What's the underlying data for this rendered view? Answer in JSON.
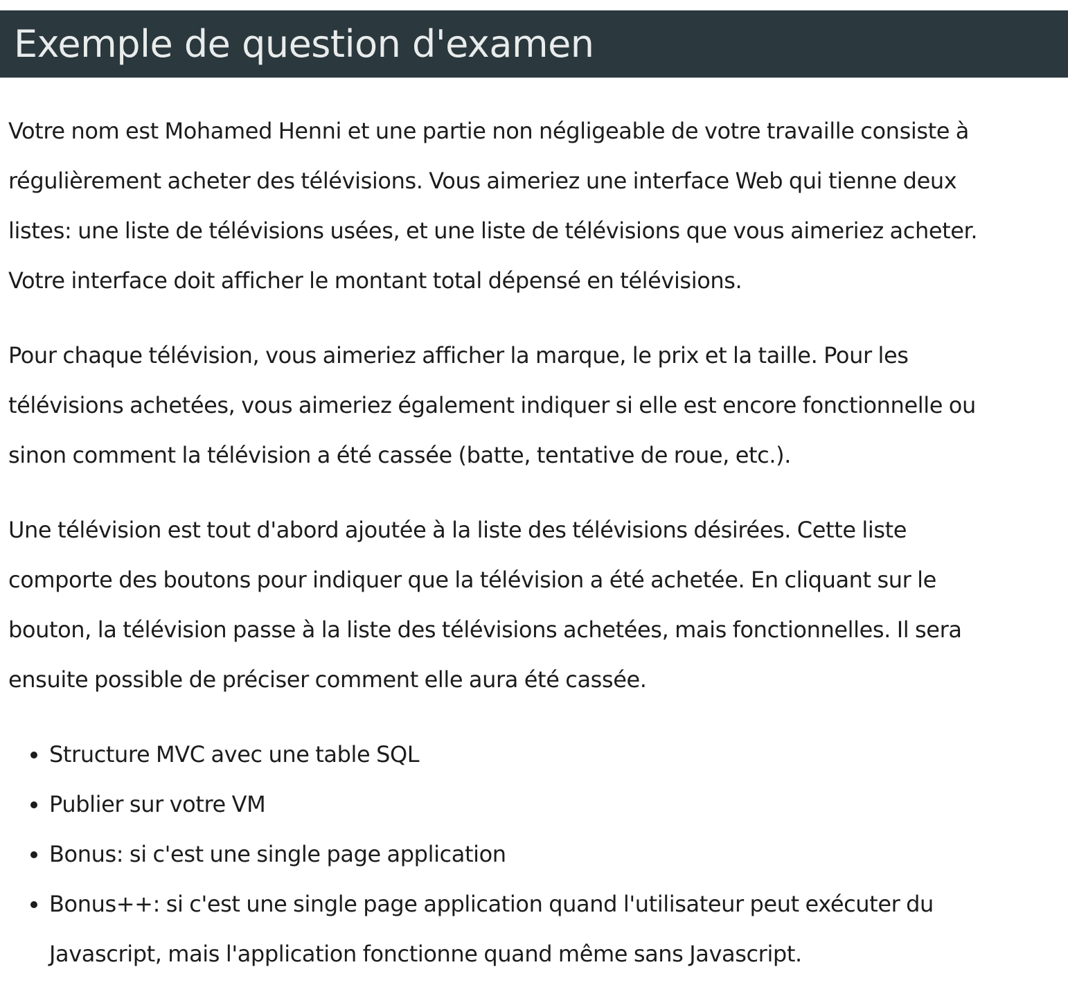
{
  "title": "Exemple de question d'examen",
  "paragraphs": [
    "Votre nom est Mohamed Henni et une partie non négligeable de votre travaille consiste à régulièrement acheter des télévisions. Vous aimeriez une interface Web qui tienne deux listes: une liste de télévisions usées, et une liste de télévisions que vous aimeriez acheter. Votre interface doit afficher le montant total dépensé en télévisions.",
    "Pour chaque télévision, vous aimeriez afficher la marque, le prix et la taille. Pour les télévisions achetées, vous aimeriez également indiquer si elle est encore fonctionnelle ou sinon comment la télévision a été cassée (batte, tentative de roue, etc.).",
    "Une télévision est tout d'abord ajoutée à la liste des télévisions désirées. Cette liste comporte des boutons pour indiquer que la télévision a été achetée. En cliquant sur le bouton, la télévision passe à la liste des télévisions achetées, mais fonctionnelles. Il sera ensuite possible de préciser comment elle aura été cassée."
  ],
  "requirements": [
    "Structure MVC avec une table SQL",
    "Publier sur votre VM",
    "Bonus: si c'est une single page application",
    "Bonus++: si c'est une single page application quand l'utilisateur peut exécuter du Javascript, mais l'application fonctionne quand même sans Javascript."
  ],
  "colors": {
    "title_bar_background": "#2b383d",
    "title_text": "#e9ecec",
    "body_text": "#1c1c1c",
    "page_background": "#ffffff"
  }
}
